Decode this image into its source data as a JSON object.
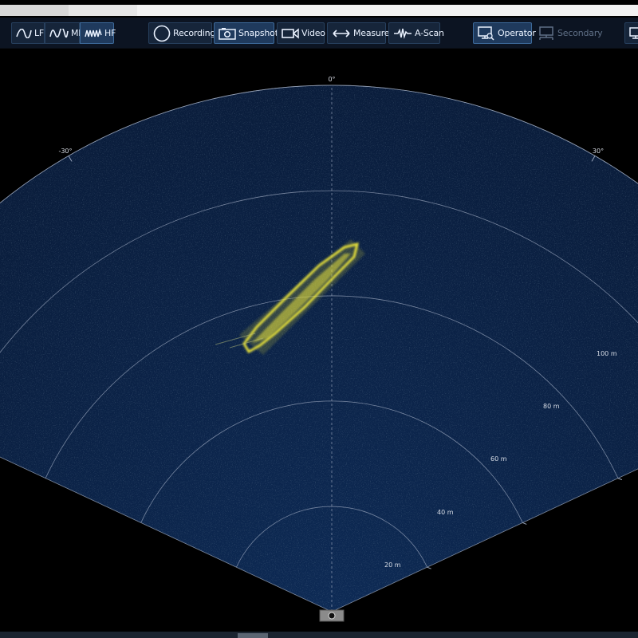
{
  "toolbar": {
    "frequency": [
      {
        "label": "LF",
        "icon": "low-frequency-wave-icon"
      },
      {
        "label": "MF",
        "icon": "mid-frequency-wave-icon"
      },
      {
        "label": "HF",
        "icon": "high-frequency-wave-icon",
        "active": true
      }
    ],
    "recording": {
      "label": "Recording",
      "icon": "record-circle-icon"
    },
    "snapshot": {
      "label": "Snapshot",
      "icon": "camera-icon",
      "active": true
    },
    "video": {
      "label": "Video",
      "icon": "video-camera-icon"
    },
    "measure": {
      "label": "Measure",
      "icon": "double-arrow-icon"
    },
    "ascan": {
      "label": "A-Scan",
      "icon": "waveform-icon"
    },
    "operator": {
      "label": "Operator",
      "icon": "operator-monitor-icon",
      "active": true
    },
    "secondary": {
      "label": "Secondary",
      "icon": "secondary-monitor-icon",
      "enabled": false
    }
  },
  "sonar": {
    "bearing_labels": [
      "-30°",
      "0°",
      "30°"
    ],
    "range_labels": [
      "20 m",
      "40 m",
      "60 m",
      "80 m",
      "100 m"
    ],
    "range_values_m": [
      20,
      40,
      60,
      80,
      100
    ],
    "bearing_values_deg": [
      -30,
      0,
      30
    ],
    "colors": {
      "background": "#000000",
      "fan": "#0b2246",
      "target": "#e8e23a",
      "grid": "#9aa6bc",
      "label": "#d8dde6"
    }
  }
}
